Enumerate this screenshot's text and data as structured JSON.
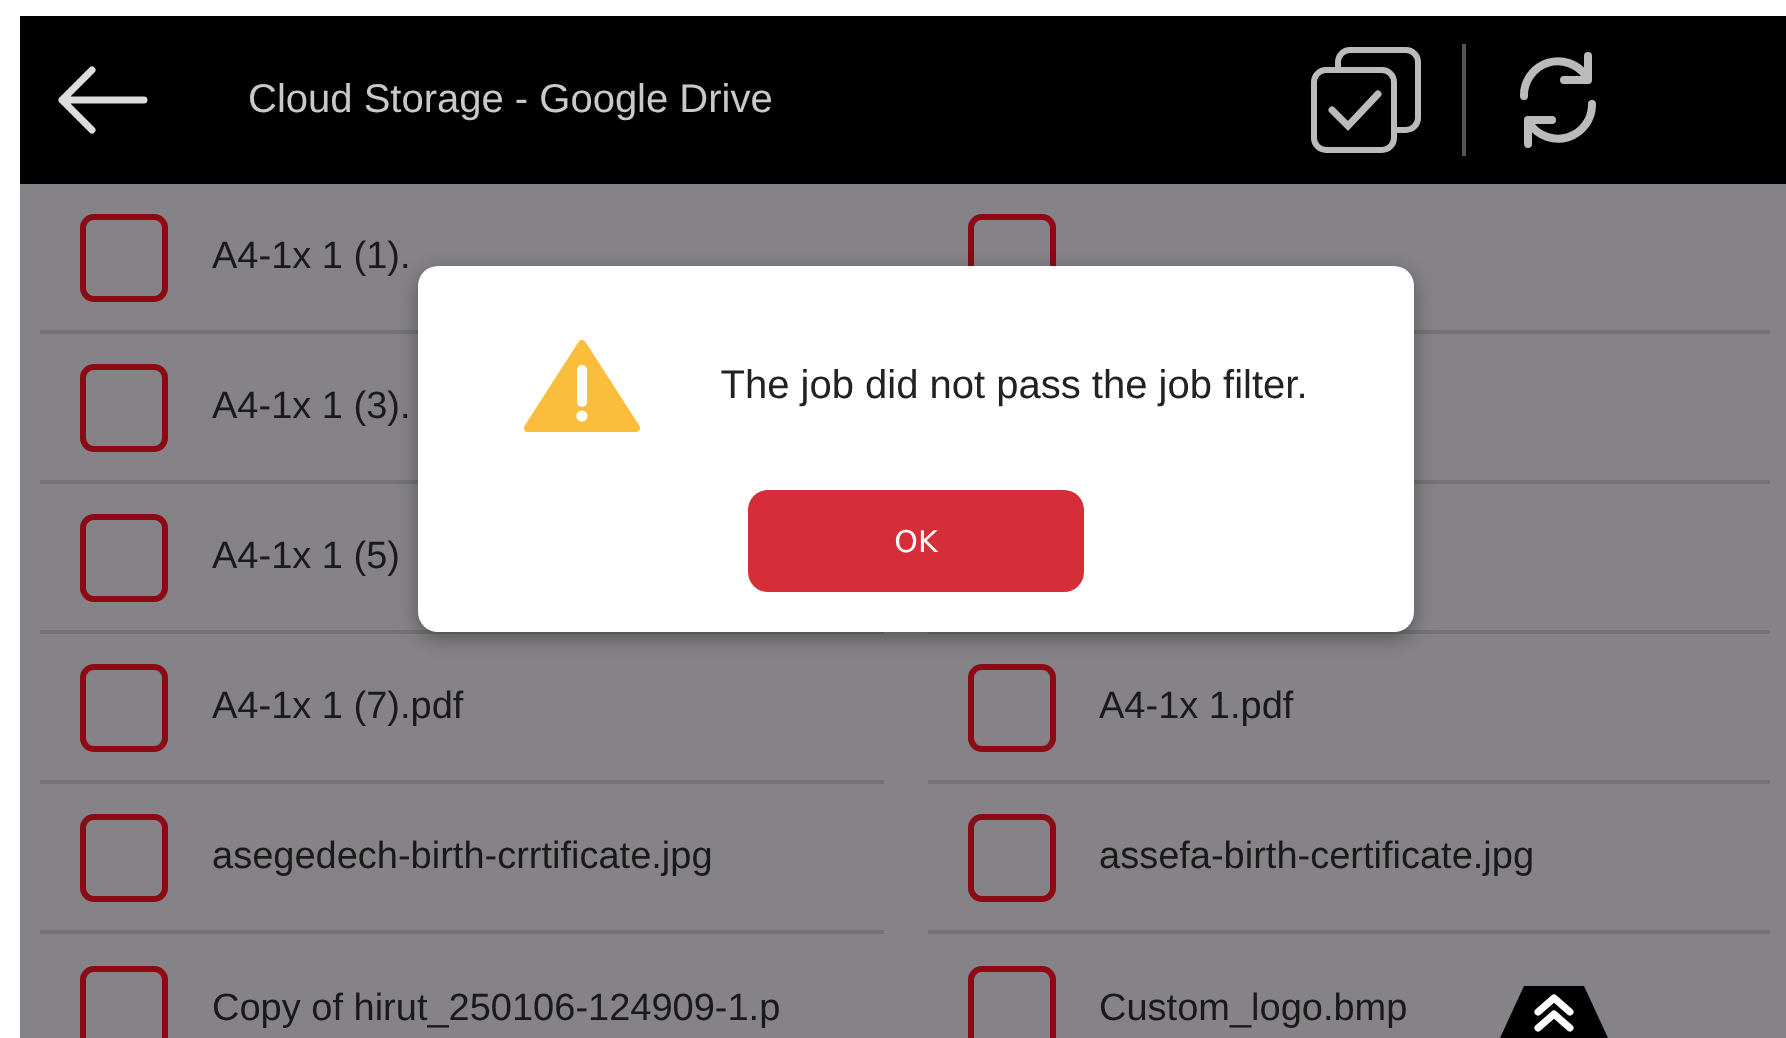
{
  "header": {
    "title": "Cloud Storage - Google Drive"
  },
  "files": [
    {
      "left": {
        "name": "A4-1x 1 (1).",
        "checked": false
      },
      "right": {
        "checked": false
      }
    },
    {
      "left": {
        "name": "A4-1x 1 (3).",
        "checked": false
      }
    },
    {
      "left": {
        "name": "A4-1x 1 (5)",
        "checked": false
      }
    },
    {
      "left": {
        "name": "A4-1x 1 (7).pdf",
        "checked": false
      },
      "right": {
        "name": "A4-1x 1.pdf",
        "checked": false
      }
    },
    {
      "left": {
        "name": "asegedech-birth-crrtificate.jpg",
        "checked": false
      },
      "right": {
        "name": "assefa-birth-certificate.jpg",
        "checked": false
      }
    },
    {
      "left": {
        "name": "Copy of hirut_250106-124909-1.p",
        "checked": false
      },
      "right": {
        "name": "Custom_logo.bmp",
        "checked": false
      }
    }
  ],
  "dialog": {
    "message": "The job did not pass the job filter.",
    "button": "OK"
  }
}
